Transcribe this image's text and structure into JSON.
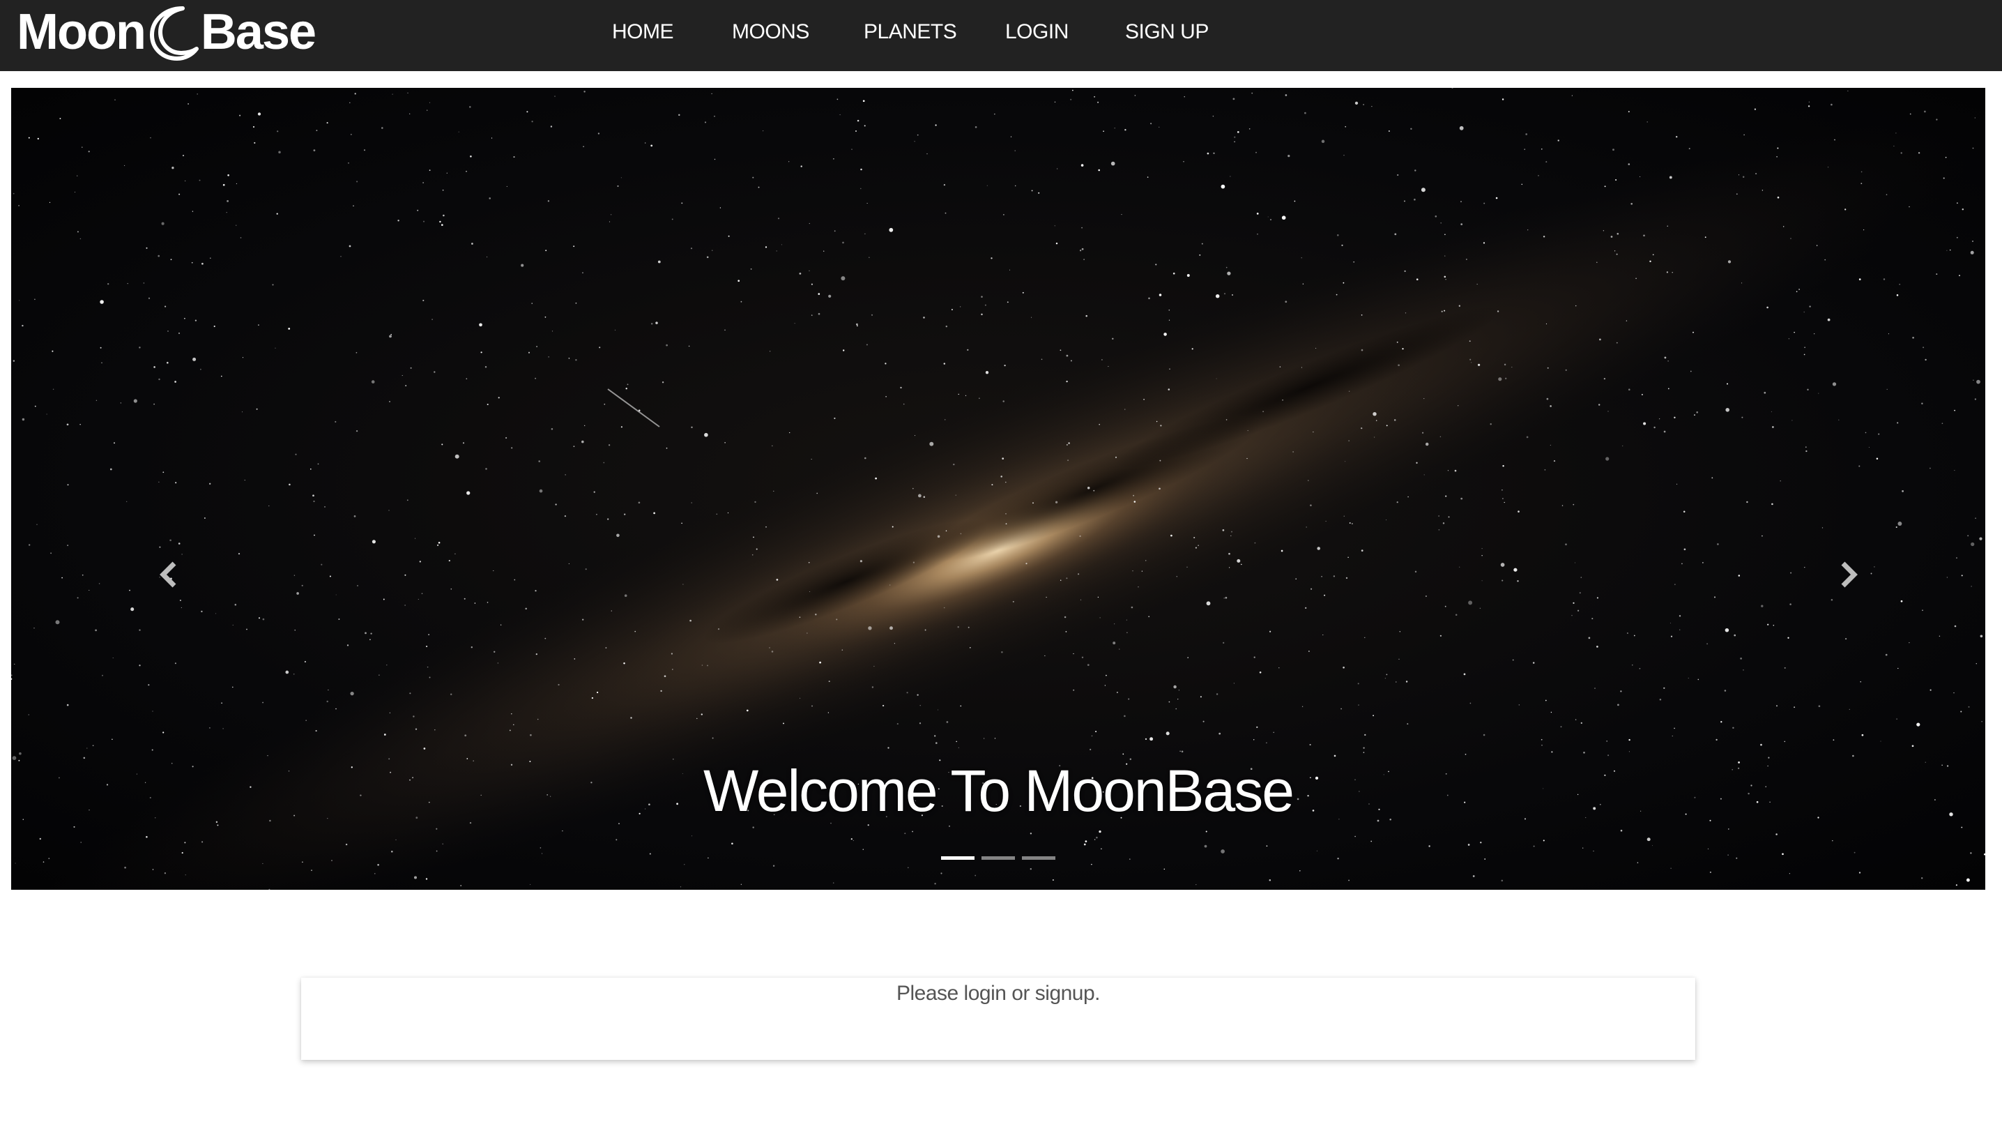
{
  "brand": {
    "name_left": "Moon",
    "name_right": "Base",
    "icon": "crescent-moon-icon"
  },
  "nav": {
    "items": [
      {
        "label": "HOME"
      },
      {
        "label": "MOONS"
      },
      {
        "label": "PLANETS"
      },
      {
        "label": "LOGIN"
      },
      {
        "label": "SIGN UP"
      }
    ]
  },
  "carousel": {
    "caption": "Welcome To MoonBase",
    "prev_icon": "chevron-left-icon",
    "next_icon": "chevron-right-icon",
    "slide_count": 3,
    "active_slide": 1
  },
  "message": {
    "text": "Please login or signup."
  },
  "colors": {
    "navbar_bg": "#222222",
    "nav_text": "#ffffff",
    "message_text": "#555555"
  }
}
